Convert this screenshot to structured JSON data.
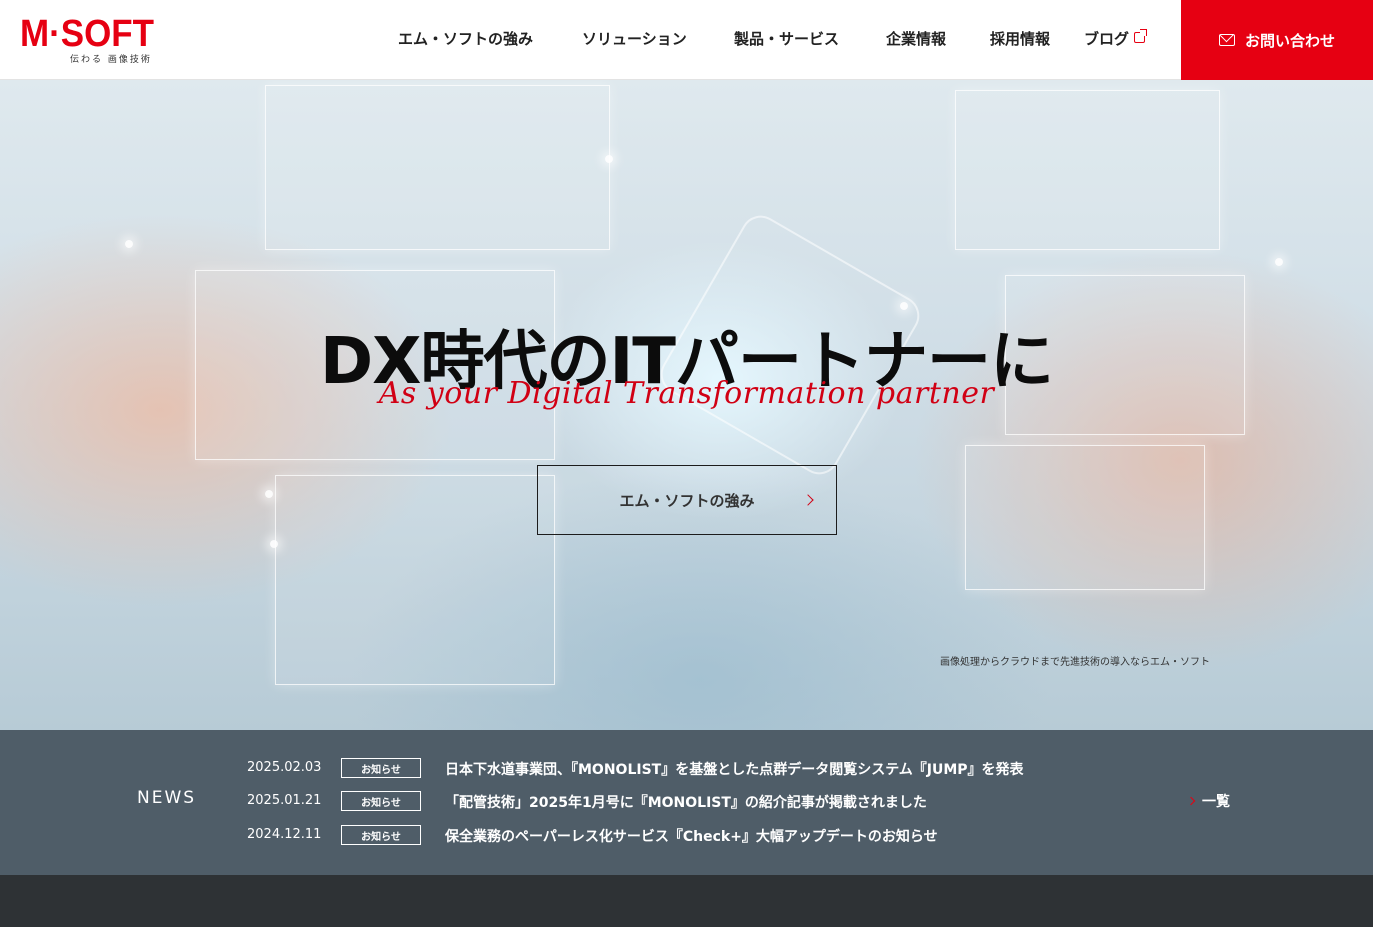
{
  "header": {
    "logo_main": "M·SOFT",
    "logo_sub": "伝わる 画像技術",
    "nav": [
      {
        "label": "エム・ソフトの強み"
      },
      {
        "label": "ソリューション"
      },
      {
        "label": "製品・サービス"
      },
      {
        "label": "企業情報"
      },
      {
        "label": "採用情報"
      },
      {
        "label": "ブログ"
      }
    ],
    "contact_label": "お問い合わせ",
    "accent_color": "#e60012"
  },
  "hero": {
    "title": "DX時代のITパートナーに",
    "subtitle": "As your Digital Transformation partner",
    "button_label": "エム・ソフトの強み",
    "caption": "画像処理からクラウドまで先進技術の導入ならエム・ソフト"
  },
  "news": {
    "title": "NEWS",
    "more_label": "一覧",
    "items": [
      {
        "date": "2025.02.03",
        "badge": "お知らせ",
        "text": "日本下水道事業団、『MONOLIST』を基盤とした点群データ閲覧システム『JUMP』を発表"
      },
      {
        "date": "2025.01.21",
        "badge": "お知らせ",
        "text": "「配管技術」2025年1月号に『MONOLIST』の紹介記事が掲載されました"
      },
      {
        "date": "2024.12.11",
        "badge": "お知らせ",
        "text": "保全業務のペーパーレス化サービス『Check+』大幅アップデートのお知らせ"
      }
    ]
  }
}
